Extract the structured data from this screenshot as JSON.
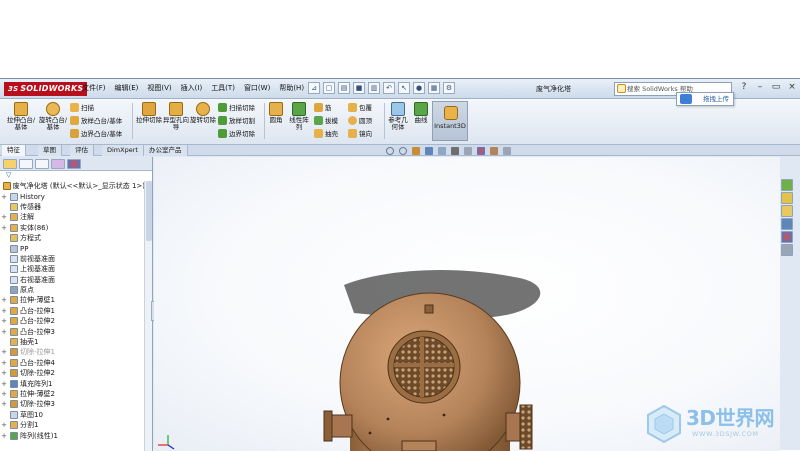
{
  "titlebar": {
    "brand_ds": "3S",
    "brand": "SOLIDWORKS",
    "menu": [
      "文件(F)",
      "编辑(E)",
      "视图(V)",
      "插入(I)",
      "工具(T)",
      "窗口(W)",
      "帮助(H)"
    ],
    "document_title": "废气净化塔",
    "search_placeholder": "搜索 SolidWorks 帮助",
    "window_controls": [
      "?",
      "–",
      "▭",
      "×"
    ]
  },
  "ribbon": {
    "buttons": {
      "extrude_boss": "拉伸凸台/基体",
      "revolve_boss": "旋转凸台/基体",
      "sweep": "扫描",
      "loft_boss": "放样凸台/基体",
      "boundary_boss": "边界凸台/基体",
      "extrude_cut": "拉伸切除",
      "hole_wizard": "异型孔向导",
      "revolve_cut": "旋转切除",
      "swept_cut": "扫描切除",
      "lofted_cut": "放样切割",
      "boundary_cut": "边界切除",
      "fillet": "圆角",
      "linear_pattern": "线性阵列",
      "rib": "筋",
      "draft": "拔模",
      "shell": "抽壳",
      "wrap": "包覆",
      "dome": "圆顶",
      "mirror": "镜向",
      "reference_geometry": "参考几何体",
      "curves": "曲线",
      "instant3d": "Instant3D"
    }
  },
  "tabs": [
    "特征",
    "草图",
    "评估",
    "DimXpert",
    "办公室产品"
  ],
  "active_tab": "特征",
  "upload_tip": "拖拽上传",
  "tree": {
    "root": "废气净化塔 (默认<<默认>_显示状态 1>)",
    "items": [
      {
        "label": "History",
        "icon": "history-icon",
        "expand": "+"
      },
      {
        "label": "传感器",
        "icon": "sensor-icon",
        "expand": ""
      },
      {
        "label": "注解",
        "icon": "annotation-icon",
        "expand": "+"
      },
      {
        "label": "实体(86)",
        "icon": "solid-bodies-icon",
        "expand": "+"
      },
      {
        "label": "方程式",
        "icon": "equations-icon",
        "expand": ""
      },
      {
        "label": "PP",
        "icon": "material-icon",
        "expand": ""
      },
      {
        "label": "前视基准面",
        "icon": "plane-icon",
        "expand": ""
      },
      {
        "label": "上视基准面",
        "icon": "plane-icon",
        "expand": ""
      },
      {
        "label": "右视基准面",
        "icon": "plane-icon",
        "expand": ""
      },
      {
        "label": "原点",
        "icon": "origin-icon",
        "expand": ""
      },
      {
        "label": "拉伸-薄壁1",
        "icon": "extrude-icon",
        "expand": "+"
      },
      {
        "label": "凸台-拉伸1",
        "icon": "extrude-icon",
        "expand": "+"
      },
      {
        "label": "凸台-拉伸2",
        "icon": "extrude-icon",
        "expand": "+"
      },
      {
        "label": "凸台-拉伸3",
        "icon": "extrude-icon",
        "expand": "+"
      },
      {
        "label": "抽壳1",
        "icon": "shell-icon",
        "expand": ""
      },
      {
        "label": "切除-拉伸1",
        "icon": "cut-icon",
        "expand": "+",
        "suppressed": true
      },
      {
        "label": "凸台-拉伸4",
        "icon": "extrude-icon",
        "expand": "+"
      },
      {
        "label": "切除-拉伸2",
        "icon": "cut-icon",
        "expand": "+"
      },
      {
        "label": "填充阵列1",
        "icon": "fill-pattern-icon",
        "expand": "+"
      },
      {
        "label": "拉伸-薄壁2",
        "icon": "extrude-icon",
        "expand": "+"
      },
      {
        "label": "切除-拉伸3",
        "icon": "cut-icon",
        "expand": "+"
      },
      {
        "label": "草图10",
        "icon": "sketch-icon",
        "expand": ""
      },
      {
        "label": "分割1",
        "icon": "split-icon",
        "expand": "+"
      },
      {
        "label": "阵列(线性)1",
        "icon": "linear-pattern-icon",
        "expand": "+"
      }
    ]
  },
  "watermark": {
    "main": "3D世界网",
    "sub": "WWW.3DSJW.COM"
  },
  "colors": {
    "accent": "#b80f1c",
    "ribbon": "#e7eef7",
    "model": "#b5835a",
    "panel_border": "#8fa3bc"
  }
}
